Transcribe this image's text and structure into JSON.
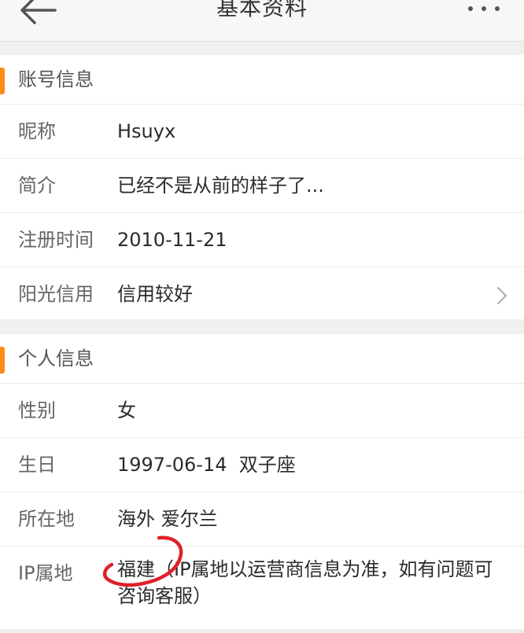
{
  "header": {
    "title": "基本资料",
    "back_icon": "arrow-left-icon",
    "more_icon": "more-dots-icon"
  },
  "account": {
    "title": "账号信息",
    "rows": [
      {
        "label": "昵称",
        "value": "Hsuyx"
      },
      {
        "label": "简介",
        "value": "已经不是从前的样子了..."
      },
      {
        "label": "注册时间",
        "value": "2010-11-21"
      },
      {
        "label": "阳光信用",
        "value": "信用较好"
      }
    ]
  },
  "personal": {
    "title": "个人信息",
    "rows": [
      {
        "label": "性别",
        "value": "女"
      },
      {
        "label": "生日",
        "value": "1997-06-14  双子座"
      },
      {
        "label": "所在地",
        "value": "海外 爱尔兰"
      },
      {
        "label": "IP属地",
        "value": "福建（IP属地以运营商信息为准，如有问题可咨询客服）"
      }
    ]
  },
  "colors": {
    "accent": "#ff8b16",
    "annotation": "#e0202a"
  }
}
